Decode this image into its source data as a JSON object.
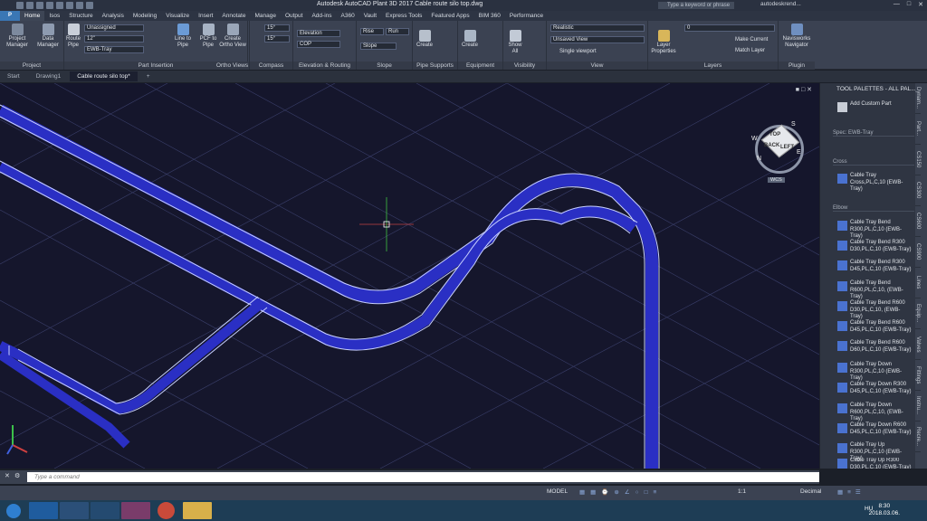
{
  "window": {
    "title": "Autodesk AutoCAD Plant 3D 2017    Cable route silo top.dwg",
    "search_placeholder": "Type a keyword or phrase",
    "user": "autodeskrend..."
  },
  "ribbon_tabs": [
    "Home",
    "Isos",
    "Structure",
    "Analysis",
    "Modeling",
    "Visualize",
    "Insert",
    "Annotate",
    "Manage",
    "Output",
    "Add-ins",
    "A360",
    "Vault",
    "Express Tools",
    "Featured Apps",
    "BIM 360",
    "Performance"
  ],
  "panels": {
    "project": {
      "label": "Project",
      "btn1": "Project Manager",
      "btn2": "Data Manager"
    },
    "part_insertion": {
      "label": "Part Insertion",
      "route_pipe": "Route Pipe",
      "assignment": "Unassigned",
      "size": "12\"",
      "spec": "EWB-Tray",
      "line_to_pipe": "Line to Pipe",
      "pcf_to_pipe": "PCF to Pipe"
    },
    "ortho": {
      "label": "Ortho Views",
      "create": "Create Ortho View"
    },
    "compass": {
      "label": "Compass",
      "angle1": "15°",
      "angle2": "15°"
    },
    "elevation": {
      "label": "Elevation & Routing",
      "elevation": "Elevation",
      "cop": "COP"
    },
    "slope": {
      "label": "Slope",
      "rise": "Rise",
      "run": "Run",
      "slope": "Slope"
    },
    "pipe_supports": {
      "label": "Pipe Supports",
      "create": "Create"
    },
    "equipment": {
      "label": "Equipment",
      "create": "Create"
    },
    "visibility": {
      "label": "Visibility",
      "show_all": "Show All"
    },
    "view": {
      "label": "View",
      "style": "Realistic",
      "saved": "Unsaved View",
      "viewport": "Single viewport"
    },
    "layers": {
      "label": "Layers",
      "layer_props": "Layer Properties",
      "current": "0",
      "make_current": "Make Current",
      "match_layer": "Match Layer"
    },
    "plugin": {
      "label": "Plugin",
      "navisworks": "Navisworks Navigator"
    }
  },
  "doc_tabs": [
    "Start",
    "Drawing1",
    "Cable route silo top*"
  ],
  "viewcube": {
    "top": "TOP",
    "front": "BACK",
    "right": "LEFT",
    "wcs": "WCS",
    "n": "N",
    "w": "W",
    "e": "E",
    "s": "S"
  },
  "palette": {
    "title": "TOOL PALETTES - ALL PAL...",
    "add_custom": "Add Custom Part",
    "spec": "Spec: EWB-Tray",
    "section_cross": "Cross",
    "section_elbow": "Elbow",
    "items": [
      "Cable Tray Cross,PL,C,10 (EWB-Tray)",
      "Cable Tray Bend R300,PL,C,10 (EWB-Tray)",
      "Cable Tray Bend R300 D30,PL,C,10 (EWB-Tray)",
      "Cable Tray Bend R300 D45,PL,C,10 (EWB-Tray)",
      "Cable Tray Bend R600,PL,C,10, (EWB-Tray)",
      "Cable Tray Bend R600 D30,PL,C,10, (EWB-Tray)",
      "Cable Tray Bend R600 D45,PL,C,10 (EWB-Tray)",
      "Cable Tray Bend R600 D60,PL,C,10 (EWB-Tray)",
      "Cable Tray Down R300,PL,C,10 (EWB-Tray)",
      "Cable Tray Down R300 D45,PL,C,10 (EWB-Tray)",
      "Cable Tray Down R600,PL,C,10, (EWB-Tray)",
      "Cable Tray Down R600 D45,PL,C,10 (EWB-Tray)",
      "Cable Tray Up R300,PL,C,10 (EWB-Tray)",
      "Cable Tray Up R300 D30,PL,C,10 (EWB-Tray)"
    ],
    "strip_tabs": [
      "Dynam...",
      "Part...",
      "CS150",
      "CS300",
      "CS600",
      "CS900",
      "Lines",
      "Equip...",
      "Valves",
      "Fittings",
      "Instru...",
      "Recre...",
      "Lines",
      "Equip..."
    ]
  },
  "command": {
    "placeholder": "Type a command"
  },
  "status": {
    "model": "MODEL",
    "scale": "1:1",
    "units": "Decimal"
  },
  "clock": {
    "time": "8:30",
    "date": "2018.03.06.",
    "lang": "HU"
  },
  "colors": {
    "tray": "#2a2fc4",
    "tray_edge": "#c8d0ff",
    "viewport_bg": "#15162c"
  }
}
